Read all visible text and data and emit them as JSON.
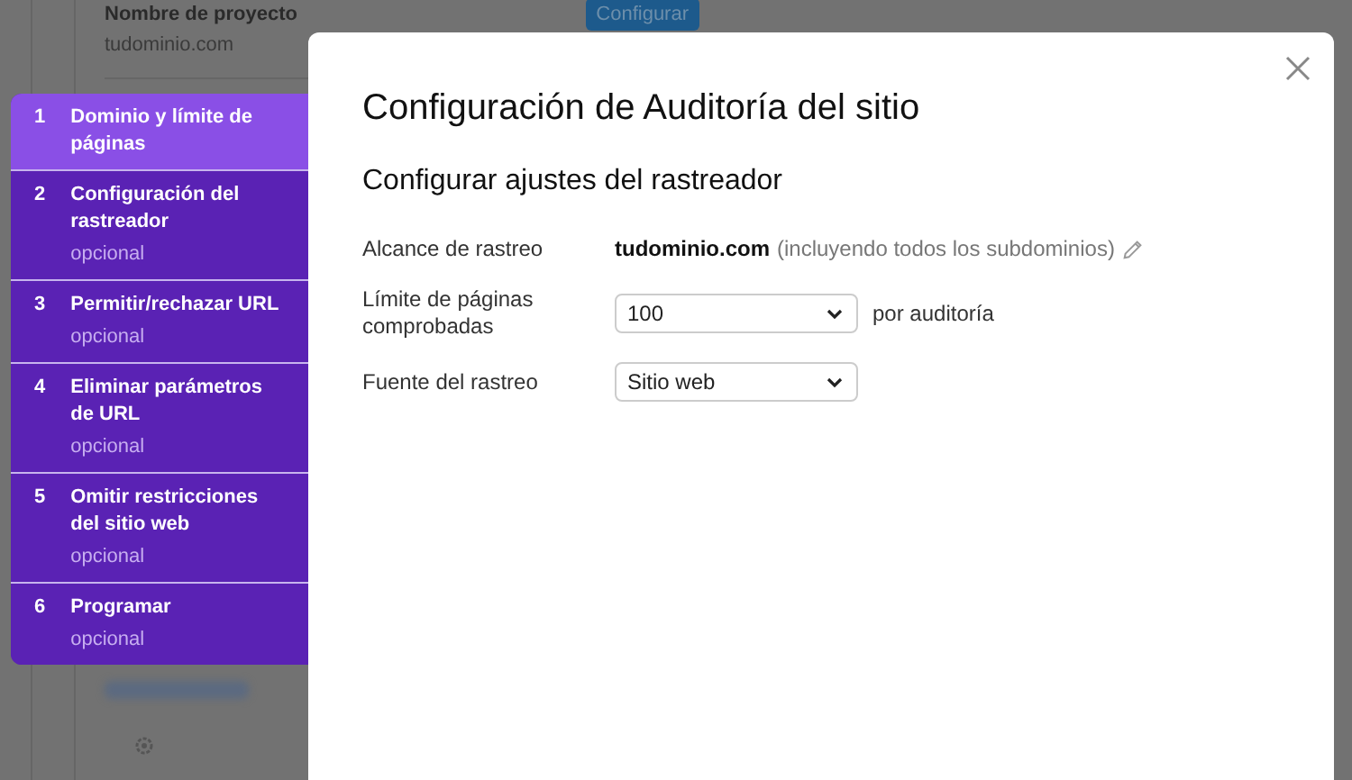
{
  "background": {
    "project_label": "Nombre de proyecto",
    "project_domain": "tudominio.com",
    "configure_button": "Configurar"
  },
  "steps": [
    {
      "number": "1",
      "title": "Dominio y límite de páginas",
      "selected": true
    },
    {
      "number": "2",
      "title": "Configuración del rastreador",
      "note": "opcional",
      "selected": false
    },
    {
      "number": "3",
      "title": "Permitir/rechazar URL",
      "note": "opcional",
      "selected": false
    },
    {
      "number": "4",
      "title": "Eliminar parámetros de URL",
      "note": "opcional",
      "selected": false
    },
    {
      "number": "5",
      "title": "Omitir restricciones del sitio web",
      "note": "opcional",
      "selected": false
    },
    {
      "number": "6",
      "title": "Programar",
      "note": "opcional",
      "selected": false
    }
  ],
  "modal": {
    "title": "Configuración de Auditoría del sitio",
    "section_title": "Configurar ajustes del rastreador",
    "rows": [
      {
        "kind": "text",
        "label": "Alcance de rastreo",
        "value": "tudominio.com",
        "hint": "(incluyendo todos los subdominios)"
      },
      {
        "kind": "select",
        "label": "Límite de páginas comprobadas",
        "value": "100",
        "suffix": "por auditoría"
      },
      {
        "kind": "select",
        "label": "Fuente del rastreo",
        "value": "Sitio web"
      }
    ]
  }
}
